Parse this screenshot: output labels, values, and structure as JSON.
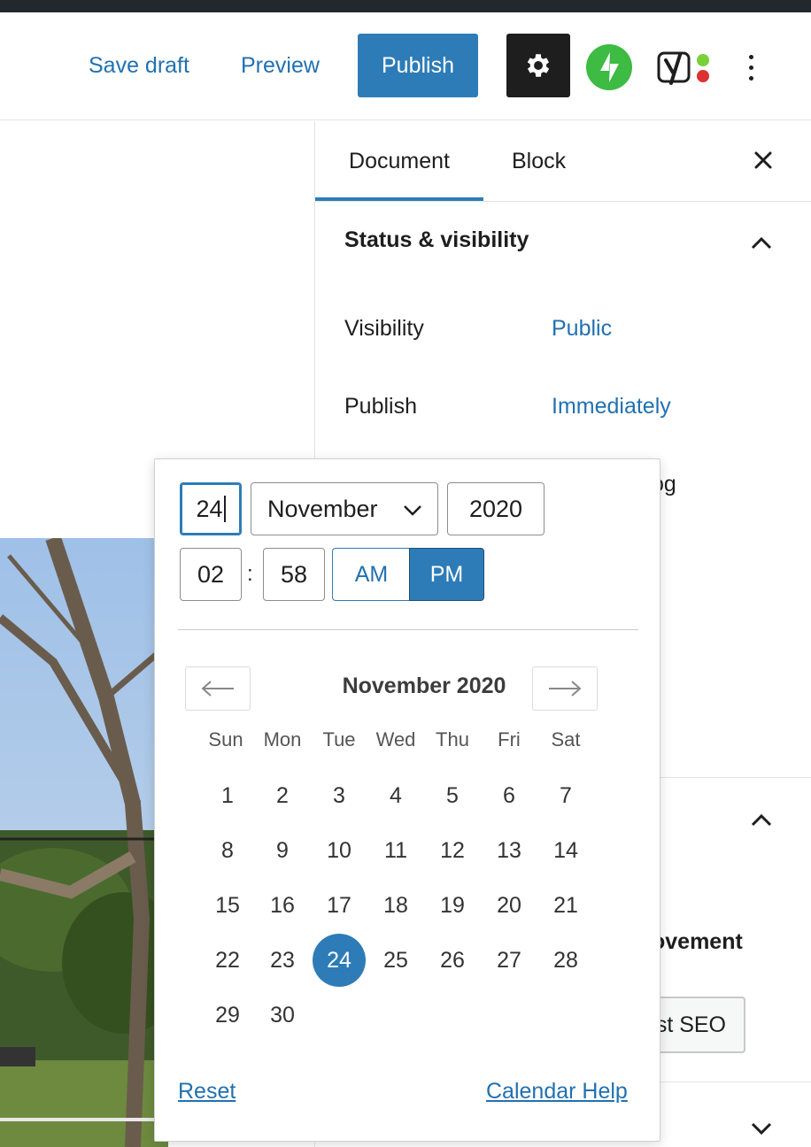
{
  "header": {
    "save_draft": "Save draft",
    "preview": "Preview",
    "publish": "Publish",
    "icons": {
      "settings": "gear-icon",
      "jetpack": "jetpack-icon",
      "yoast": "yoast-icon",
      "more": "more-vertical-icon"
    }
  },
  "sidebar": {
    "tabs": [
      {
        "label": "Document",
        "active": true
      },
      {
        "label": "Block",
        "active": false
      }
    ],
    "panel_title": "Status & visibility",
    "rows": [
      {
        "label": "Visibility",
        "value": "Public"
      },
      {
        "label": "Publish",
        "value": "Immediately"
      }
    ],
    "partial_og": "og",
    "partial_improvement": "ovement",
    "seo_button": "st SEO"
  },
  "datepicker": {
    "day": "24",
    "month": "November",
    "year": "2020",
    "hour": "02",
    "minute": "58",
    "colon": ":",
    "am": "AM",
    "pm": "PM",
    "meridiem_selected": "PM",
    "month_title": "November 2020",
    "weekdays": [
      "Sun",
      "Mon",
      "Tue",
      "Wed",
      "Thu",
      "Fri",
      "Sat"
    ],
    "days": [
      "1",
      "2",
      "3",
      "4",
      "5",
      "6",
      "7",
      "8",
      "9",
      "10",
      "11",
      "12",
      "13",
      "14",
      "15",
      "16",
      "17",
      "18",
      "19",
      "20",
      "21",
      "22",
      "23",
      "24",
      "25",
      "26",
      "27",
      "28",
      "29",
      "30"
    ],
    "selected_day": "24",
    "reset": "Reset",
    "calendar_help": "Calendar Help"
  },
  "colors": {
    "accent": "#2d7cb7",
    "link": "#2271b1",
    "dark": "#1e1e1e",
    "jetpack": "#3dbb43"
  }
}
